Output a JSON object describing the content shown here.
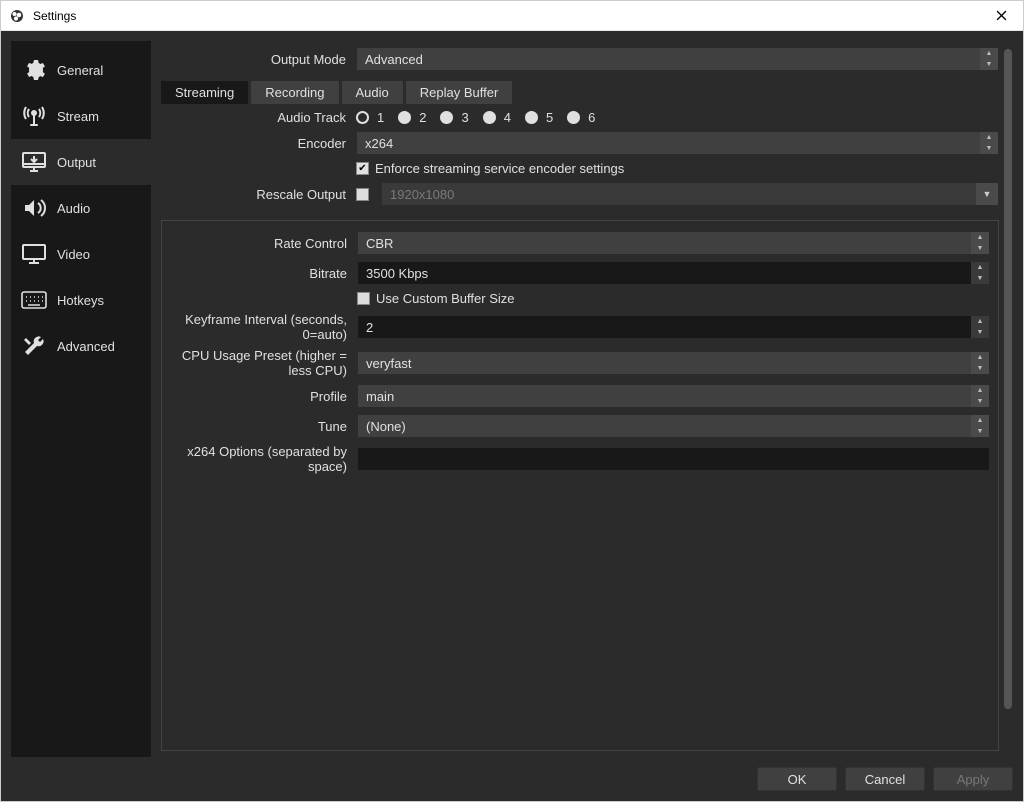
{
  "window": {
    "title": "Settings"
  },
  "sidebar": {
    "items": [
      {
        "label": "General"
      },
      {
        "label": "Stream"
      },
      {
        "label": "Output"
      },
      {
        "label": "Audio"
      },
      {
        "label": "Video"
      },
      {
        "label": "Hotkeys"
      },
      {
        "label": "Advanced"
      }
    ]
  },
  "outputMode": {
    "label": "Output Mode",
    "value": "Advanced"
  },
  "tabs": [
    {
      "label": "Streaming"
    },
    {
      "label": "Recording"
    },
    {
      "label": "Audio"
    },
    {
      "label": "Replay Buffer"
    }
  ],
  "streaming": {
    "audioTrack": {
      "label": "Audio Track",
      "options": [
        "1",
        "2",
        "3",
        "4",
        "5",
        "6"
      ],
      "selected": "1"
    },
    "encoder": {
      "label": "Encoder",
      "value": "x264"
    },
    "enforce": {
      "label": "Enforce streaming service encoder settings",
      "checked": true
    },
    "rescale": {
      "label": "Rescale Output",
      "checked": false,
      "value": "1920x1080"
    },
    "rateControl": {
      "label": "Rate Control",
      "value": "CBR"
    },
    "bitrate": {
      "label": "Bitrate",
      "value": "3500 Kbps"
    },
    "customBuffer": {
      "label": "Use Custom Buffer Size",
      "checked": false
    },
    "keyframe": {
      "label": "Keyframe Interval (seconds, 0=auto)",
      "value": "2"
    },
    "cpuPreset": {
      "label": "CPU Usage Preset (higher = less CPU)",
      "value": "veryfast"
    },
    "profile": {
      "label": "Profile",
      "value": "main"
    },
    "tune": {
      "label": "Tune",
      "value": "(None)"
    },
    "x264opts": {
      "label": "x264 Options (separated by space)",
      "value": ""
    }
  },
  "buttons": {
    "ok": "OK",
    "cancel": "Cancel",
    "apply": "Apply"
  }
}
